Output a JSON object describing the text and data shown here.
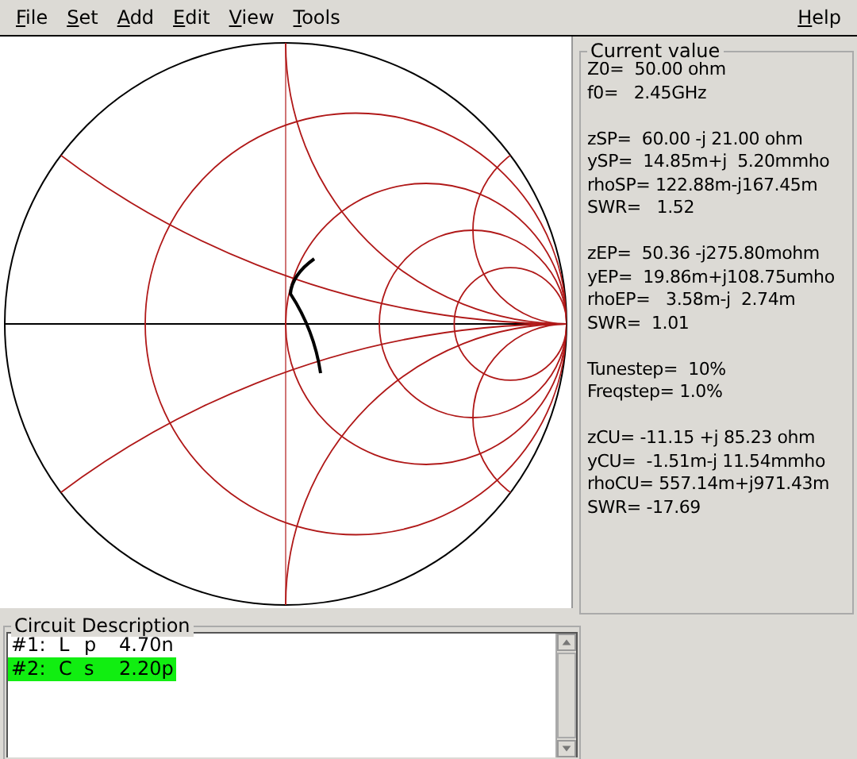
{
  "menu": [
    {
      "label": "File"
    },
    {
      "label": "Set"
    },
    {
      "label": "Add"
    },
    {
      "label": "Edit"
    },
    {
      "label": "View"
    },
    {
      "label": "Tools"
    },
    {
      "label": "Help"
    }
  ],
  "current_value": {
    "title": "Current value",
    "groups": [
      [
        "Z0=  50.00 ohm",
        "f0=   2.45GHz"
      ],
      [
        "zSP=  60.00 -j 21.00 ohm",
        "ySP=  14.85m+j  5.20mmho",
        "rhoSP= 122.88m-j167.45m",
        "SWR=   1.52"
      ],
      [
        "zEP=  50.36 -j275.80mohm",
        "yEP=  19.86m+j108.75umho",
        "rhoEP=   3.58m-j  2.74m",
        "SWR=  1.01"
      ],
      [
        "Tunestep=  10%",
        "Freqstep= 1.0%"
      ],
      [
        "zCU= -11.15 +j 85.23 ohm",
        "yCU=  -1.51m-j 11.54mmho",
        "rhoCU= 557.14m+j971.43m",
        "SWR= -17.69"
      ]
    ]
  },
  "circuit_description": {
    "title": "Circuit Description",
    "rows": [
      {
        "index": "#1:",
        "element": "L",
        "connection": "p",
        "value": "4.70n",
        "selected": false
      },
      {
        "index": "#2:",
        "element": "C",
        "connection": "s",
        "value": "2.20p",
        "selected": true
      }
    ]
  }
}
